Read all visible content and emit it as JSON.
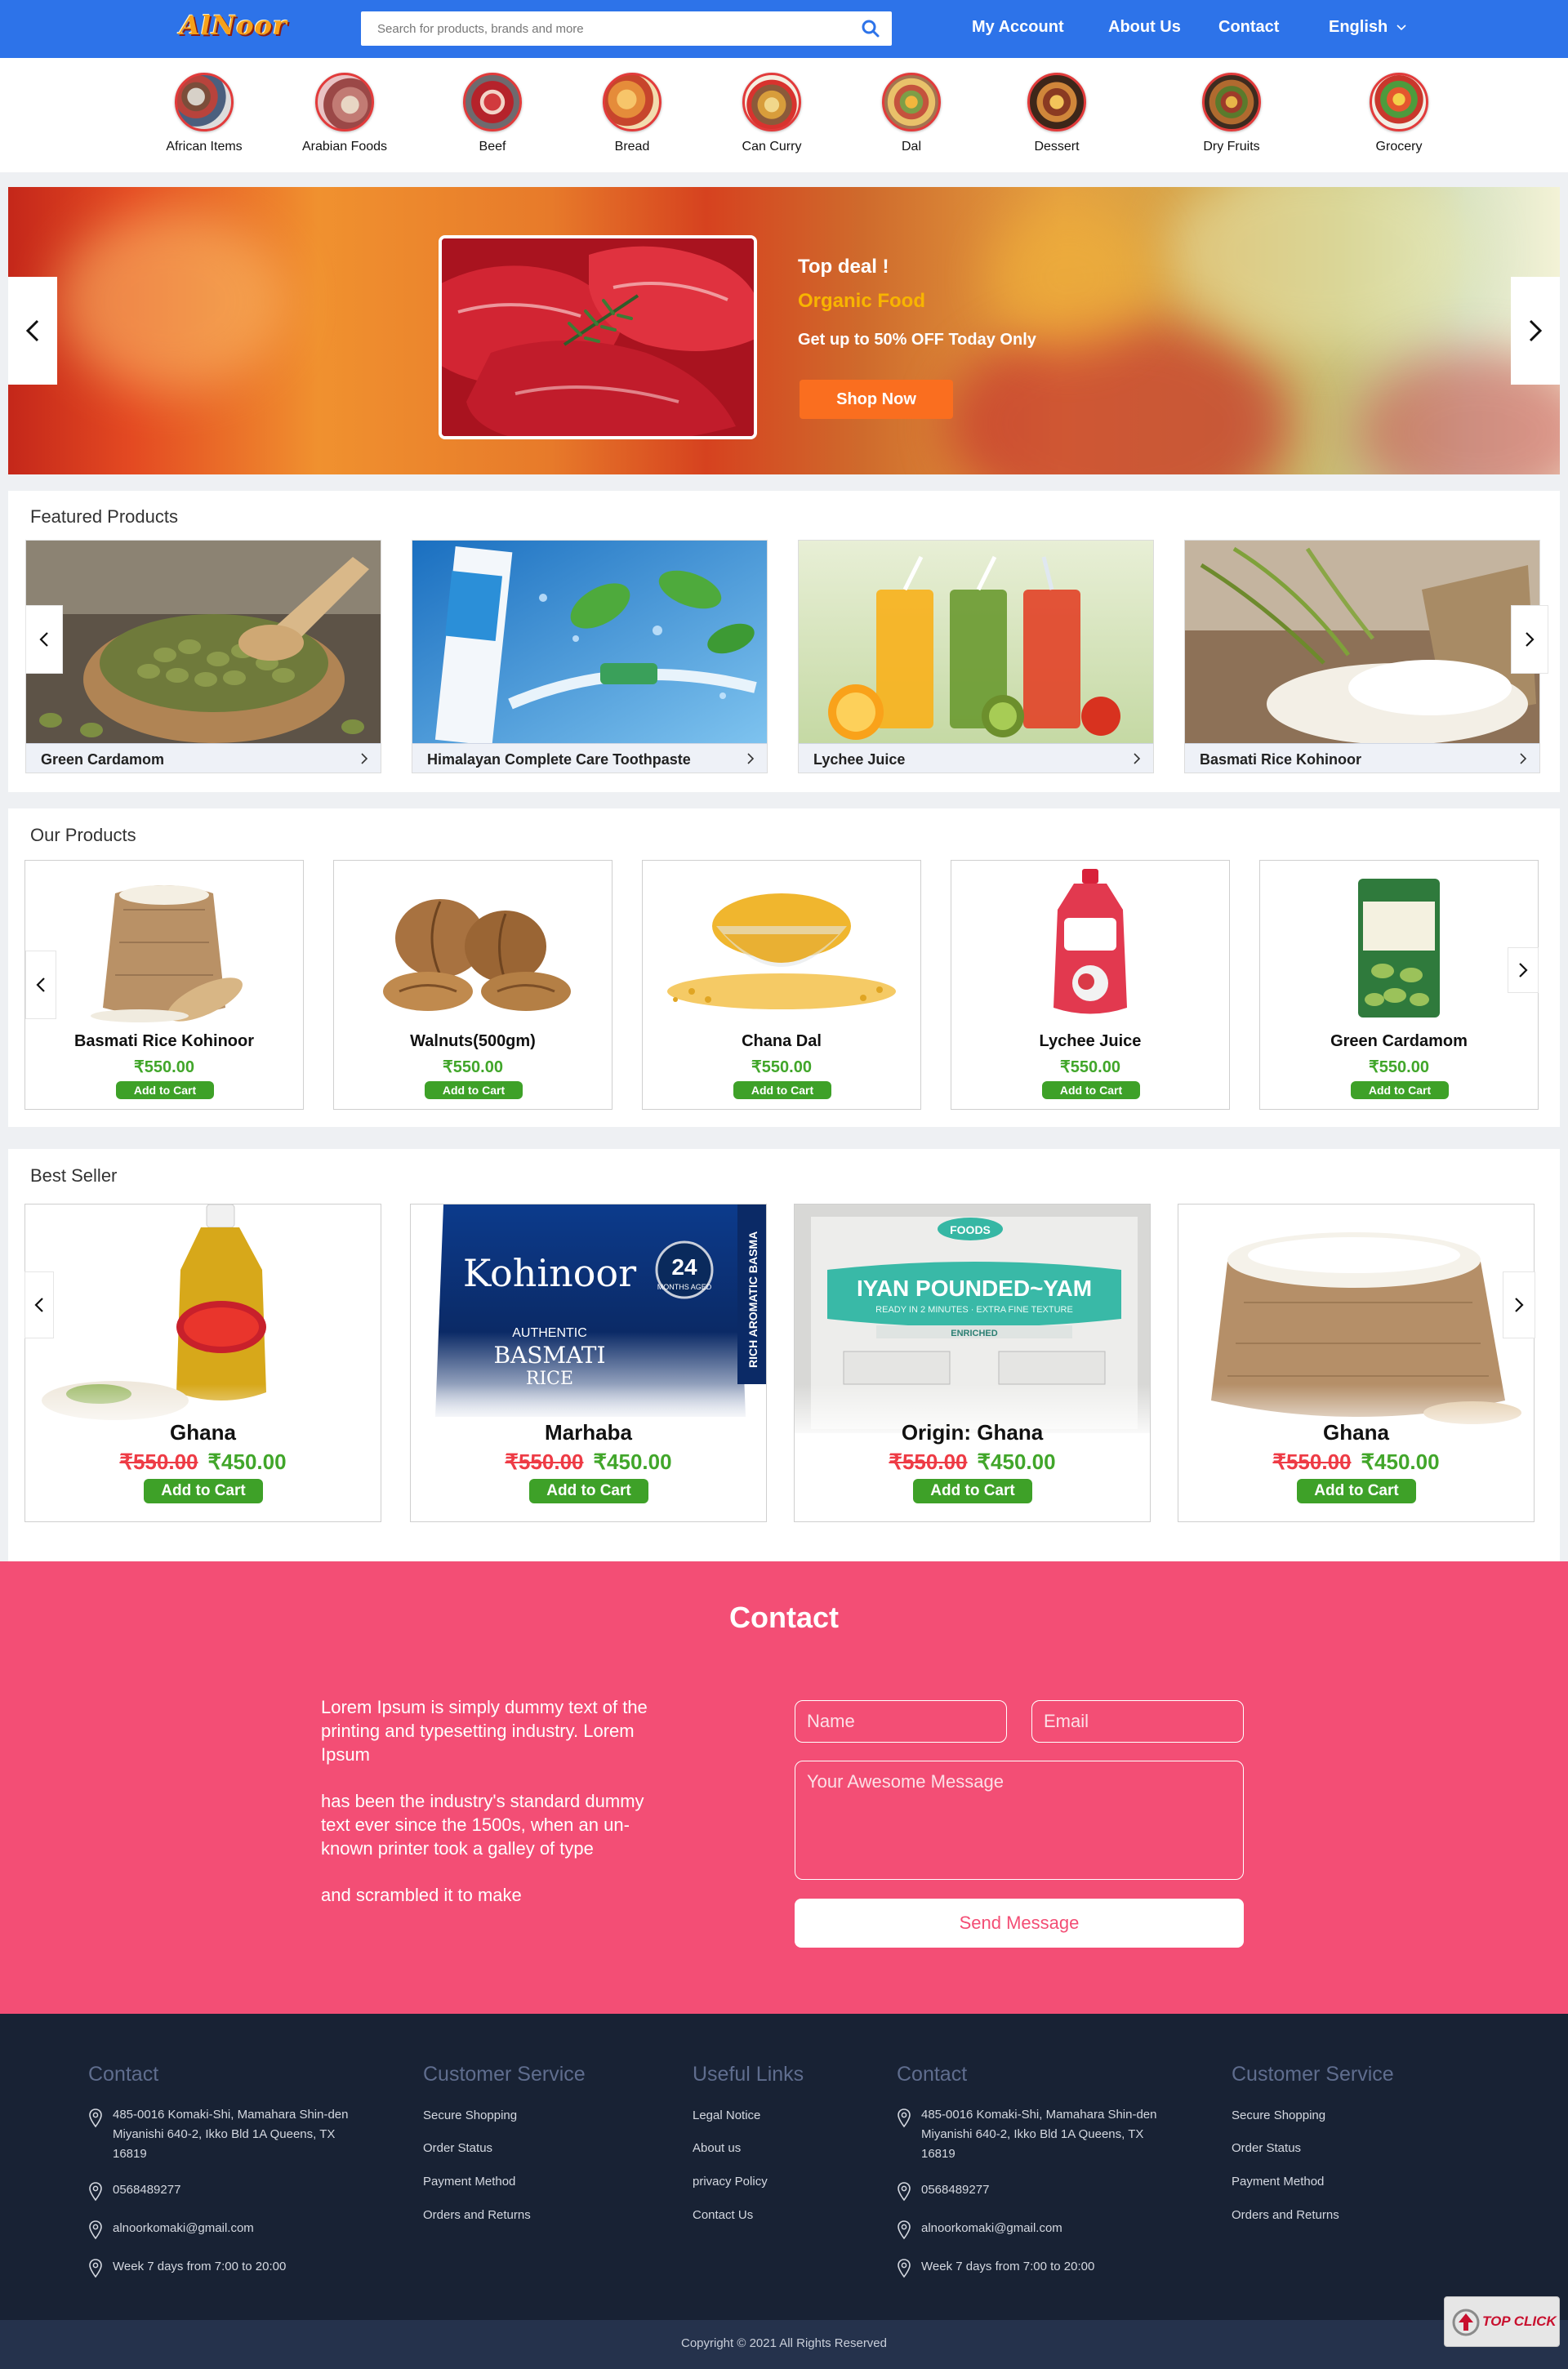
{
  "header": {
    "logo": "AlNoor",
    "search_placeholder": "Search for products, brands and more",
    "nav": [
      "My Account",
      "About Us",
      "Contact"
    ],
    "language": "English"
  },
  "categories": [
    "African Items",
    "Arabian Foods",
    "Beef",
    "Bread",
    "Can Curry",
    "Dal",
    "Dessert",
    "Dry Fruits",
    "Grocery"
  ],
  "hero": {
    "title": "Top deal !",
    "subtitle": "Organic Food",
    "description": "Get up to 50% OFF Today Only",
    "button": "Shop Now"
  },
  "featured": {
    "title": "Featured Products",
    "items": [
      "Green Cardamom",
      "Himalayan Complete Care Toothpaste",
      "Lychee Juice",
      "Basmati Rice Kohinoor"
    ]
  },
  "our_products": {
    "title": "Our Products",
    "items": [
      {
        "name": "Basmati Rice Kohinoor",
        "price": "₹550.00",
        "button": "Add to Cart"
      },
      {
        "name": "Walnuts(500gm)",
        "price": "₹550.00",
        "button": "Add to Cart"
      },
      {
        "name": "Chana Dal",
        "price": "₹550.00",
        "button": "Add to Cart"
      },
      {
        "name": "Lychee Juice",
        "price": "₹550.00",
        "button": "Add to Cart"
      },
      {
        "name": "Green Cardamom",
        "price": "₹550.00",
        "button": "Add to Cart"
      }
    ]
  },
  "best_seller": {
    "title": "Best Seller",
    "items": [
      {
        "name": "Ghana",
        "old_price": "₹550.00",
        "price": "₹450.00",
        "button": "Add to Cart"
      },
      {
        "name": "Marhaba",
        "old_price": "₹550.00",
        "price": "₹450.00",
        "button": "Add to Cart",
        "pack_brand": "Kohinoor",
        "pack_line1": "AUTHENTIC",
        "pack_line2": "BASMATI",
        "pack_line3": "RICE",
        "pack_side": "RICH AROMATIC BASMA",
        "pack_badge_num": "24",
        "pack_badge_txt": "MONTHS AGED"
      },
      {
        "name": "Origin: Ghana",
        "old_price": "₹550.00",
        "price": "₹450.00",
        "button": "Add to Cart",
        "pack_text": "IYAN POUNDED~YAM",
        "pack_sub": "READY IN 2 MINUTES · EXTRA FINE TEXTURE",
        "pack_brand": "FOODS",
        "pack_tag": "ENRICHED"
      },
      {
        "name": "Ghana",
        "old_price": "₹550.00",
        "price": "₹450.00",
        "button": "Add to Cart"
      }
    ]
  },
  "contact": {
    "title": "Contact",
    "para1": "Lorem Ipsum is simply dummy text of the printing and typesetting industry. Lorem Ipsum",
    "para2": "has been the industry's standard dummy text ever since the 1500s, when an un-known printer took a galley of type",
    "para3": "and scrambled it to make",
    "name_placeholder": "Name",
    "email_placeholder": "Email",
    "message_placeholder": "Your Awesome Message",
    "send": "Send Message"
  },
  "footer": {
    "col_contact": {
      "title": "Contact",
      "address": "485-0016 Komaki-Shi, Mamahara Shin-den Miyanishi 640-2, Ikko Bld 1A Queens, TX 16819",
      "phone": "0568489277",
      "email": "alnoorkomaki@gmail.com",
      "hours": "Week 7 days from 7:00 to 20:00"
    },
    "col_service": {
      "title": "Customer Service",
      "links": [
        "Secure Shopping",
        "Order Status",
        "Payment Method",
        "Orders and Returns"
      ]
    },
    "col_links": {
      "title": "Useful Links",
      "links": [
        "Legal Notice",
        "About us",
        "privacy Policy",
        "Contact Us"
      ]
    },
    "copyright": "Copyright © 2021 All Rights Reserved",
    "topclick": "TOP CLICK"
  },
  "colors": {
    "header_blue": "#2d73e9",
    "accent_orange": "#fa6e1f",
    "price_green": "#41a62a",
    "old_price_red": "#ee3b45",
    "contact_pink": "#f34e75",
    "footer_navy": "#182234"
  }
}
